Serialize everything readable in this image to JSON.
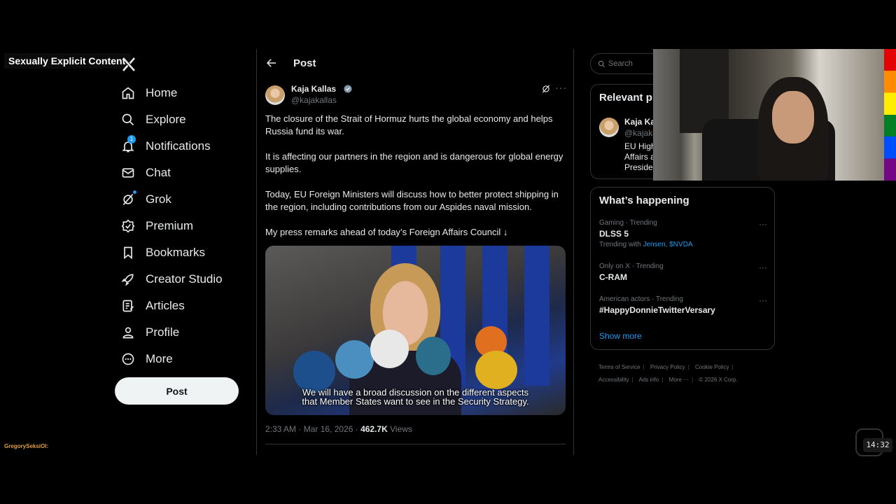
{
  "overlay": {
    "label": "Sexually Explicit Content",
    "streamer_tag": "GregorySeksiOl:",
    "clock": "14:32"
  },
  "sidebar": {
    "items": [
      {
        "label": "Home",
        "icon": "home-icon"
      },
      {
        "label": "Explore",
        "icon": "search-icon"
      },
      {
        "label": "Notifications",
        "icon": "bell-icon",
        "badge": "1"
      },
      {
        "label": "Chat",
        "icon": "mail-icon"
      },
      {
        "label": "Grok",
        "icon": "grok-icon"
      },
      {
        "label": "Premium",
        "icon": "premium-icon"
      },
      {
        "label": "Bookmarks",
        "icon": "bookmark-icon"
      },
      {
        "label": "Creator Studio",
        "icon": "rocket-icon"
      },
      {
        "label": "Articles",
        "icon": "articles-icon"
      },
      {
        "label": "Profile",
        "icon": "person-icon"
      },
      {
        "label": "More",
        "icon": "more-circle-icon"
      }
    ],
    "post_label": "Post"
  },
  "main": {
    "title": "Post",
    "author": {
      "name": "Kaja Kallas",
      "handle": "@kajakallas"
    },
    "paragraphs": [
      "The closure of the Strait of Hormuz hurts the global economy and helps Russia fund its war.",
      "It is affecting our partners in the region and is dangerous for global energy supplies.",
      "Today, EU Foreign Ministers will discuss how to better protect shipping in the region, including contributions from our Aspides naval mission.",
      "My press remarks ahead of today’s Foreign Affairs Council ↓"
    ],
    "video": {
      "caption_line1": "We will have a broad discussion on the different aspects",
      "caption_line2": "that Member States want to see in the Security Strategy."
    },
    "meta": {
      "time": "2:33 AM · Mar 16, 2026 · ",
      "views_count": "462.7K",
      "views_label": " Views"
    }
  },
  "right": {
    "search_placeholder": "Search",
    "relevant": {
      "title": "Relevant p",
      "name": "Kaja Ka",
      "handle": "@kajaka",
      "bio_lines": [
        "EU High",
        "Affairs a",
        "Presiden"
      ]
    },
    "happening": {
      "title": "What’s happening",
      "trends": [
        {
          "meta": "Gaming · Trending",
          "name": "DLSS 5",
          "with_prefix": "Trending with ",
          "with_links": "Jensen, $NVDA"
        },
        {
          "meta": "Only on X · Trending",
          "name": "C-RAM"
        },
        {
          "meta": "American actors · Trending",
          "name": "#HappyDonnieTwitterVersary"
        }
      ],
      "show_more": "Show more"
    },
    "footer": {
      "row1": [
        "Terms of Service",
        "Privacy Policy",
        "Cookie Policy"
      ],
      "row2": [
        "Accessibility",
        "Ads info",
        "More ···",
        "© 2026 X Corp."
      ]
    }
  }
}
